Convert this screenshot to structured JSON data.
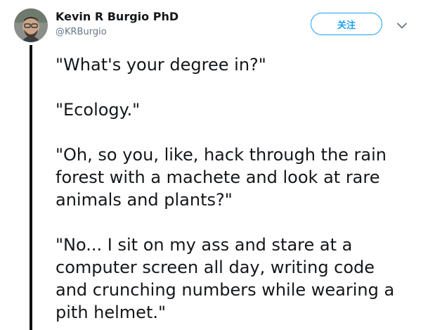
{
  "author": {
    "display_name": "Kevin R Burgio PhD",
    "handle": "@KRBurgio"
  },
  "actions": {
    "follow_label": "关注",
    "caret_icon": "chevron-down-icon"
  },
  "tweet": {
    "paragraphs": [
      "\"What's your degree in?\"",
      "\"Ecology.\"",
      "\"Oh, so you, like, hack through the rain\nforest with a machete and look at rare\nanimals and plants?\"",
      "\"No... I sit on my ass and stare at a\ncomputer screen all day, writing code\nand crunching numbers while wearing a\npith helmet.\""
    ]
  },
  "colors": {
    "accent": "#1da1f2",
    "text": "#14171a",
    "secondary_text": "#657786",
    "thread_line": "#111111"
  }
}
